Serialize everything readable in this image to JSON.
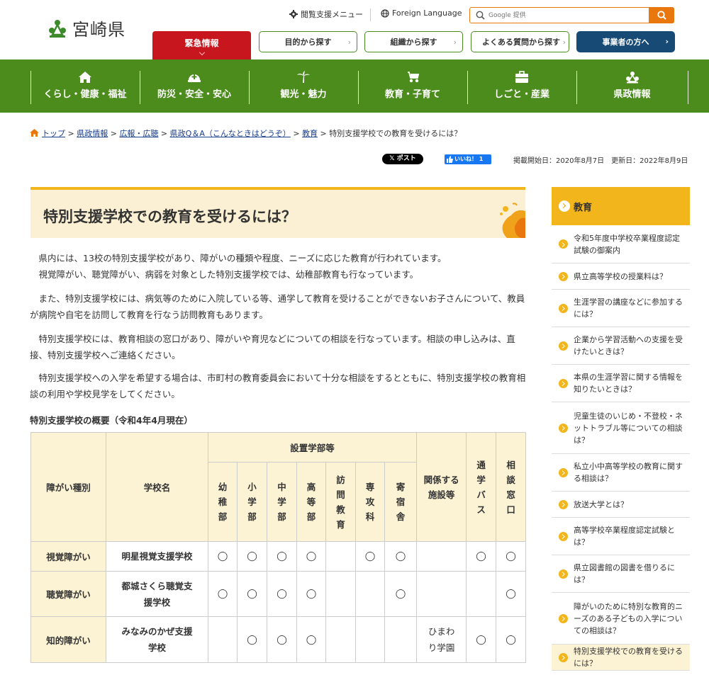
{
  "header": {
    "logo_text": "宮崎県",
    "accessibility_menu": "閲覧支援メニュー",
    "foreign_language": "Foreign Language",
    "search_placeholder": "Google 提供",
    "emergency": "緊急情報",
    "buttons": [
      {
        "label": "目的から探す"
      },
      {
        "label": "組織から探す"
      },
      {
        "label": "よくある質問から探す"
      }
    ],
    "business": "事業者の方へ"
  },
  "nav": [
    {
      "label": "くらし・健康・福祉",
      "icon": "house-icon"
    },
    {
      "label": "防災・安全・安心",
      "icon": "helmet-icon"
    },
    {
      "label": "観光・魅力",
      "icon": "palm-tree-icon"
    },
    {
      "label": "教育・子育て",
      "icon": "stroller-icon"
    },
    {
      "label": "しごと・産業",
      "icon": "briefcase-icon"
    },
    {
      "label": "県政情報",
      "icon": "prefecture-emblem-icon"
    }
  ],
  "breadcrumb": {
    "items": [
      "トップ",
      "県政情報",
      "広報・広聴",
      "県政Q＆A（こんなときはどうぞ）",
      "教育"
    ],
    "current": "特別支援学校での教育を受けるには？"
  },
  "share": {
    "x_post": "ポスト",
    "fb_like": "いいね！ 1"
  },
  "dates": "掲載開始日：2020年8月7日　更新日：2022年8月9日",
  "title": "特別支援学校での教育を受けるには？",
  "paragraphs": [
    "県内には、13校の特別支援学校があり、障がいの種類や程度、ニーズに応じた教育が行われています。",
    "視覚障がい、聴覚障がい、病弱を対象とした特別支援学校では、幼稚部教育も行なっています。",
    "また、特別支援学校には、病気等のために入院している等、通学して教育を受けることができないお子さんについて、教員が病院や自宅を訪問して教育を行なう訪問教育もあります。",
    "特別支援学校には、教育相談の窓口があり、障がいや育児などについての相談を行なっています。相談の申し込みは、直接、特別支援学校へご連絡ください。",
    "特別支援学校への入学を希望する場合は、市町村の教育委員会において十分な相談をするとともに、特別支援学校の教育相談の利用や学校見学をしてください。"
  ],
  "table": {
    "title": "特別支援学校の概要（令和4年4月現在）",
    "headers": {
      "type": "障がい種別",
      "name": "学校名",
      "departments": "設置学部等",
      "dept_cols": [
        "幼稚部",
        "小学部",
        "中学部",
        "高等部",
        "訪問教育",
        "専攻科",
        "寄宿舎"
      ],
      "facility": "関係する施設等",
      "bus": "通学バス",
      "consult": "相談窓口"
    },
    "mark": "◯",
    "rows": [
      {
        "type": "視覚障がい",
        "name": "明星視覚支援学校",
        "marks": [
          true,
          true,
          true,
          true,
          false,
          true,
          true
        ],
        "facility": "",
        "bus": true,
        "consult": true
      },
      {
        "type": "聴覚障がい",
        "name": "都城さくら聴覚支援学校",
        "marks": [
          true,
          true,
          true,
          true,
          false,
          false,
          true
        ],
        "facility": "",
        "bus": false,
        "consult": true
      },
      {
        "type": "知的障がい",
        "name": "みなみのかぜ支援学校",
        "marks": [
          false,
          true,
          true,
          true,
          false,
          false,
          false
        ],
        "facility": "ひまわり学園",
        "bus": true,
        "consult": true
      }
    ]
  },
  "sidebar": {
    "heading": "教育",
    "items": [
      "令和5年度中学校卒業程度認定試験の御案内",
      "県立高等学校の授業料は？",
      "生涯学習の講座などに参加するには？",
      "企業から学習活動への支援を受けたいときは？",
      "本県の生涯学習に関する情報を知りたいときは？",
      "児童生徒のいじめ・不登校・ネットトラブル等についての相談は？",
      "私立小中高等学校の教育に関する相談は？",
      "放送大学とは？",
      "高等学校卒業程度認定試験とは？",
      "県立図書館の図書を借りるには？",
      "障がいのために特別な教育的ニーズのある子どもの入学についての相談は？",
      "特別支援学校での教育を受けるには？"
    ]
  },
  "colors": {
    "nav_green": "#4c8c1d",
    "emergency_red": "#c8161e",
    "accent_orange": "#e8770e",
    "business_navy": "#174a74",
    "title_yellow": "#f3b51c",
    "title_bg": "#fbf0d3"
  }
}
